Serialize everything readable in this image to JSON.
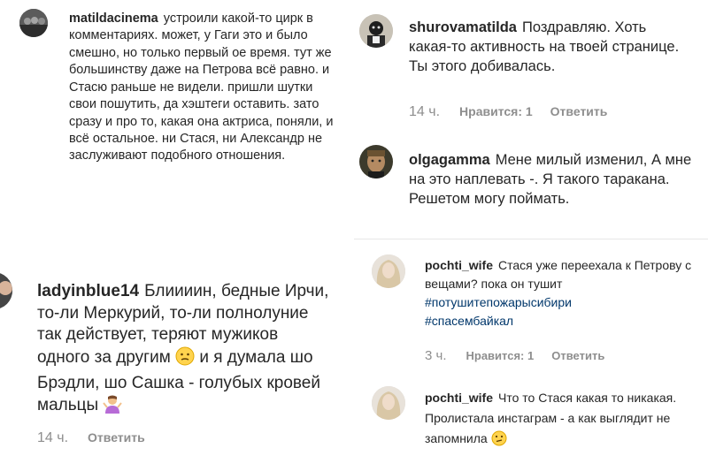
{
  "comments": [
    {
      "id": "c1",
      "username": "matildacinema",
      "text": "устроили какой-то цирк в комментариях. может, у Гаги это и было смешно, но только первый ое время. тут же большинству даже на Петрова всё равно. и Стасю раньше не видели. пришли шутки свои пошутить, да хэштеги оставить. зато сразу и про то, какая она актриса, поняли, и всё остальное. ни Стася, ни Александр не заслуживают подобного отношения."
    },
    {
      "id": "c2",
      "username": "shurovamatilda",
      "text": "Поздравляю. Хоть какая-то активность на твоей странице. Ты этого добивалась.",
      "time": "14 ч.",
      "likes": "Нравится: 1",
      "reply": "Ответить"
    },
    {
      "id": "c3",
      "username": "olgagamma",
      "text": "Мене милый изменил, А мне на это наплевать -. Я такого таракана. Решетом могу поймать."
    },
    {
      "id": "c4",
      "username": "ladyinblue14",
      "text": "Блиииин, бедные Ирчи, то-ли Меркурий, то-ли полнолуние так действует, теряют мужиков одного за другим",
      "text_after": "и я думала шо Брэдли, шо Сашка - голубых кровей мальцы",
      "time": "14 ч.",
      "reply": "Ответить"
    },
    {
      "id": "c5",
      "username": "pochti_wife",
      "text": "Стася уже переехала к Петрову с вещами? пока он тушит",
      "hashtags": [
        "#потушитепожарысибири",
        "#спасембайкал"
      ],
      "time": "3 ч.",
      "likes": "Нравится: 1",
      "reply": "Ответить"
    },
    {
      "id": "c6",
      "username": "pochti_wife",
      "text": "Что то Стася какая то никакая. Пролистала инстаграм - а как выглядит не запомнила"
    }
  ],
  "icons": {
    "thinking": "thinking-face-icon",
    "shrug": "person-shrugging-icon",
    "confused": "confused-face-icon"
  }
}
